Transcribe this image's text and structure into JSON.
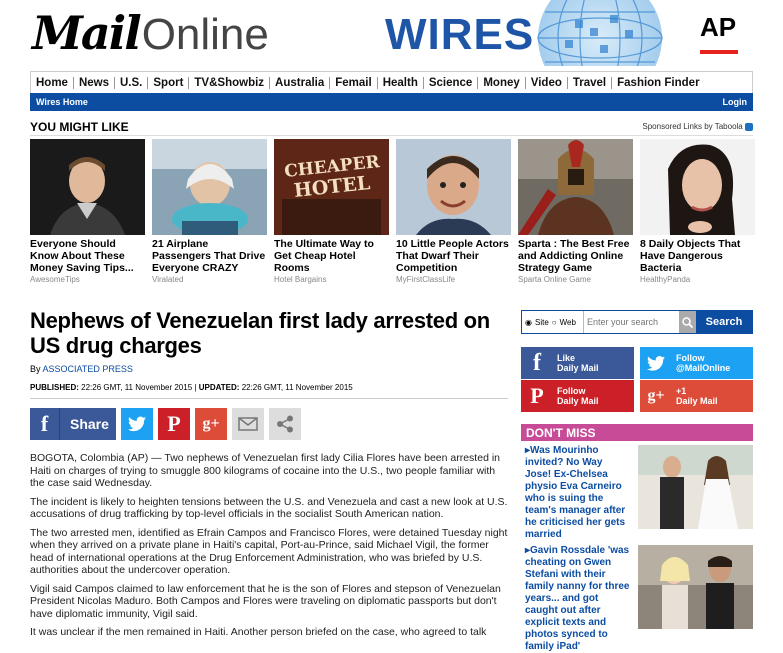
{
  "header": {
    "logo_bold": "Mail",
    "logo_light": "Online",
    "wires": "WIRES",
    "ap": "AP"
  },
  "nav": {
    "items": [
      "Home",
      "News",
      "U.S.",
      "Sport",
      "TV&Showbiz",
      "Australia",
      "Femail",
      "Health",
      "Science",
      "Money",
      "Video",
      "Travel",
      "Fashion Finder"
    ],
    "sub_left": "Wires Home",
    "sub_right": "Login"
  },
  "you_might_like": {
    "title": "YOU MIGHT LIKE",
    "sponsor": "Sponsored Links by Taboola",
    "cards": [
      {
        "title": "Everyone Should Know About These Money Saving Tips...",
        "source": "AwesomeTips"
      },
      {
        "title": "21 Airplane Passengers That Drive Everyone CRAZY",
        "source": "Viralated"
      },
      {
        "title": "The Ultimate Way to Get Cheap Hotel Rooms",
        "source": "Hotel Bargains",
        "sign1": "CHEAPER",
        "sign2": "HOTEL"
      },
      {
        "title": "10 Little People Actors That Dwarf Their Competition",
        "source": "MyFirstClassLife"
      },
      {
        "title": "Sparta : The Best Free and Addicting Online Strategy Game",
        "source": "Sparta Online Game"
      },
      {
        "title": "8 Daily Objects That Have Dangerous Bacteria",
        "source": "HealthyPanda"
      }
    ]
  },
  "article": {
    "headline": "Nephews of Venezuelan first lady arrested on US drug charges",
    "by_prefix": "By",
    "author": "ASSOCIATED PRESS",
    "published_label": "PUBLISHED:",
    "published": "22:26 GMT, 11 November 2015",
    "updated_label": "UPDATED:",
    "updated": "22:26 GMT, 11 November 2015",
    "share_label": "Share",
    "paragraphs": [
      "BOGOTA, Colombia (AP) — Two nephews of Venezuelan first lady Cilia Flores have been arrested in Haiti on charges of trying to smuggle 800 kilograms of cocaine into the U.S., two people familiar with the case said Wednesday.",
      "The incident is likely to heighten tensions between the U.S. and Venezuela and cast a new look at U.S. accusations of drug trafficking by top-level officials in the socialist South American nation.",
      "The two arrested men, identified as Efrain Campos and Francisco Flores, were detained Tuesday night when they arrived on a private plane in Haiti's capital, Port-au-Prince, said Michael Vigil, the former head of international operations at the Drug Enforcement Administration, who was briefed by U.S. authorities about the undercover operation.",
      "Vigil said Campos claimed to law enforcement that he is the son of Flores and stepson of Venezuelan President Nicolas Maduro. Both Campos and Flores were traveling on diplomatic passports but don't have diplomatic immunity, Vigil said.",
      "It was unclear if the men remained in Haiti. Another person briefed on the case, who agreed to talk"
    ]
  },
  "search": {
    "site": "Site",
    "web": "Web",
    "placeholder": "Enter your search",
    "button": "Search"
  },
  "social": {
    "fb": {
      "l1": "Like",
      "l2": "Daily Mail"
    },
    "tw": {
      "l1": "Follow",
      "l2": "@MailOnline"
    },
    "pin": {
      "l1": "Follow",
      "l2": "Daily Mail"
    },
    "gp": {
      "l1": "+1",
      "l2": "Daily Mail"
    }
  },
  "dont_miss": {
    "title": "DON'T MISS",
    "items": [
      {
        "text": "Was Mourinho invited? No Way Jose! Ex-Chelsea physio Eva Carneiro who is suing the team's manager after he criticised her gets married"
      },
      {
        "text": "Gavin Rossdale 'was cheating on Gwen Stefani with their family nanny for three years... and got caught out after explicit texts and photos synced to family iPad'"
      }
    ]
  },
  "colors": {
    "brand_blue": "#0c4da2",
    "dont_miss_pink": "#c84b97",
    "facebook": "#3b5998",
    "twitter": "#1da1f2",
    "pinterest": "#cb2027",
    "gplus": "#dd4b39"
  }
}
